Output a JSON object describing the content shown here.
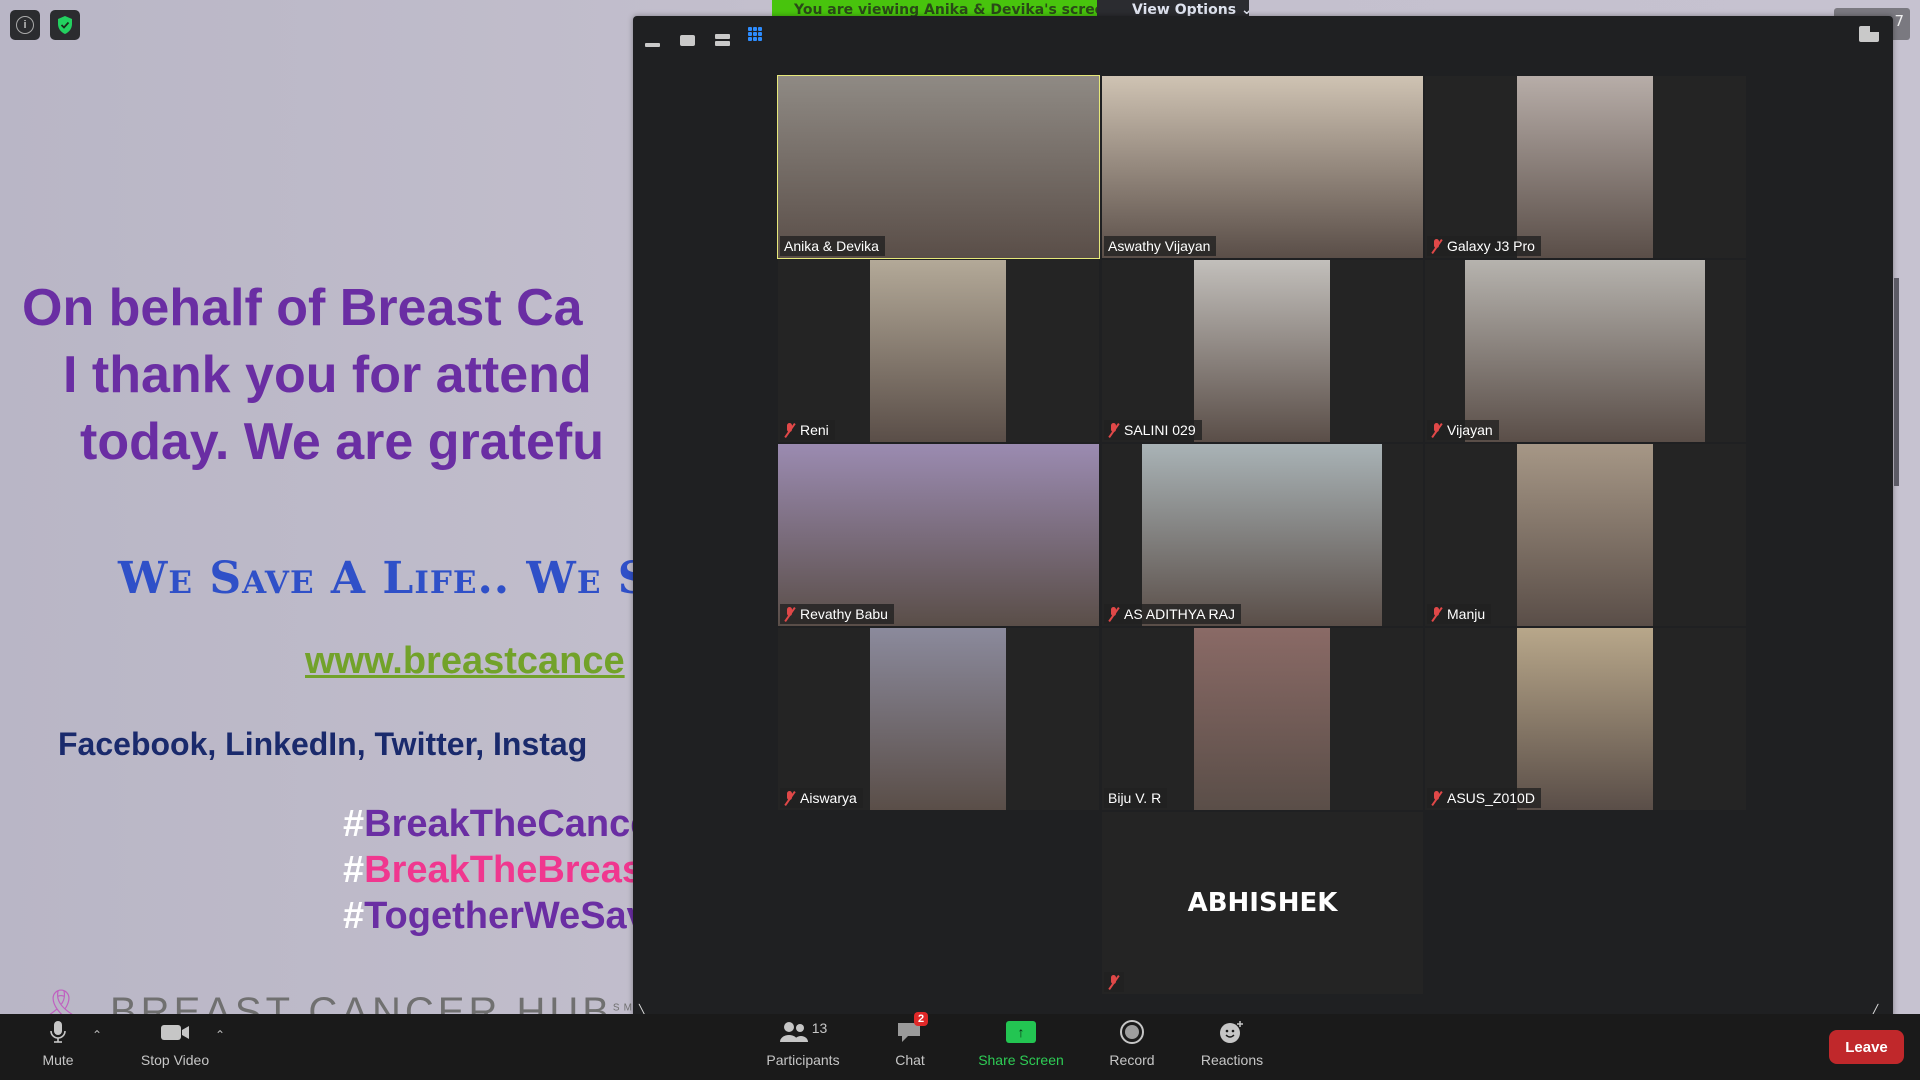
{
  "shared_slide": {
    "lines": [
      "On behalf of Breast Ca",
      "I thank you for attend",
      "today. We are gratefu"
    ],
    "motto": "We Save A Life.. We Sa",
    "website": "www.breastcance",
    "social": "Facebook, LinkedIn, Twitter, Instag",
    "hashtags": [
      {
        "hash": "#",
        "text": "BreakTheCance"
      },
      {
        "hash": "#",
        "text": "BreakTheBreast"
      },
      {
        "hash": "#",
        "text": "TogetherWeSav"
      }
    ],
    "logo_text": "BREAST CANCER HUB",
    "logo_mark": "SM"
  },
  "top_controls": {
    "info_icon": "info-icon",
    "security_icon": "shield-check-icon",
    "viewing_banner": "You are viewing Anika & Devika's screen",
    "view_options": "View Options ⌄",
    "right_tab_digit": "7"
  },
  "meeting_window": {
    "layout_buttons": [
      "minimize",
      "speaker-view",
      "gallery-strip",
      "gallery-grid"
    ],
    "active_layout": "gallery-grid"
  },
  "participants": [
    {
      "name": "Anika & Devika",
      "muted": false,
      "active_speaker": true,
      "video": true,
      "bg": "#8f8a84"
    },
    {
      "name": "Aswathy Vijayan",
      "muted": false,
      "video": true,
      "bg": "#cfc3b3"
    },
    {
      "name": "Galaxy J3 Pro",
      "muted": true,
      "video": true,
      "bg": "#b7ada8"
    },
    {
      "name": "Reni",
      "muted": true,
      "video": true,
      "bg": "#b3a998"
    },
    {
      "name": "SALINI 029",
      "muted": true,
      "video": true,
      "bg": "#c2bfbb"
    },
    {
      "name": "Vijayan",
      "muted": true,
      "video": true,
      "bg": "#b6b3ae"
    },
    {
      "name": "Revathy Babu",
      "muted": true,
      "video": true,
      "bg": "#9b8bb1"
    },
    {
      "name": "AS ADITHYA RAJ",
      "muted": true,
      "video": true,
      "bg": "#a9b3b6"
    },
    {
      "name": "Manju",
      "muted": true,
      "video": true,
      "bg": "#a69786"
    },
    {
      "name": "Aiswarya",
      "muted": true,
      "video": true,
      "bg": "#8b8a9c"
    },
    {
      "name": "Biju V. R",
      "muted": false,
      "video": true,
      "bg": "#8a6a66"
    },
    {
      "name": "ASUS_Z010D",
      "muted": true,
      "video": true,
      "bg": "#b8a78a"
    },
    {
      "name": "ABHISHEK",
      "muted": true,
      "video": false
    }
  ],
  "toolbar": {
    "mute": "Mute",
    "stop_video": "Stop Video",
    "participants": "Participants",
    "participants_count": "13",
    "chat": "Chat",
    "chat_badge": "2",
    "share_screen": "Share Screen",
    "record": "Record",
    "reactions": "Reactions",
    "leave": "Leave"
  },
  "colors": {
    "accent_blue": "#2d8cff",
    "share_green": "#23c552",
    "leave_red": "#c0282b",
    "active_speaker": "#e6e87a"
  }
}
